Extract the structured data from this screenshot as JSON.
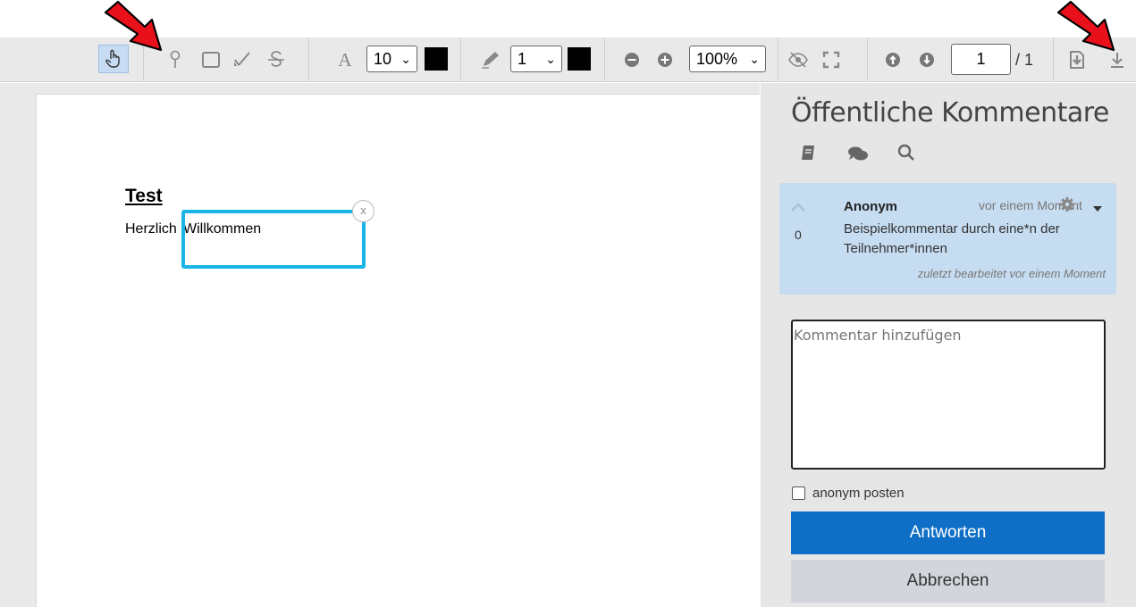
{
  "toolbar": {
    "font_size": "10",
    "line_width": "1",
    "zoom": "100%",
    "page_current": "1",
    "page_total": "/ 1",
    "colors": {
      "text_color": "#000000",
      "line_color": "#000000",
      "hand_active_bg": "#c7dcf3"
    },
    "icons": [
      "hand-pointer-icon",
      "map-pin-icon",
      "rectangle-icon",
      "highlighter-icon",
      "strikethrough-icon",
      "font-icon",
      "pencil-icon",
      "zoom-out-icon",
      "zoom-in-icon",
      "eye-slash-icon",
      "fullscreen-icon",
      "arrow-up-icon",
      "arrow-down-icon",
      "export-icon",
      "download-icon"
    ]
  },
  "document": {
    "heading": "Test",
    "body_text_1": "Herzlich",
    "body_text_2": "Willkommen",
    "annotation_close": "x",
    "annotation_color": "#1ab5e8"
  },
  "sidebar": {
    "title": "Öffentliche Kommentare",
    "comment": {
      "author": "Anonym",
      "time": "vor einem Moment",
      "votes": "0",
      "text_line1": "Beispielkommentar durch eine*n der",
      "text_line2": "Teilnehmer*innen",
      "edited": "zuletzt bearbeitet vor einem Moment",
      "bg": "#c6dcf1"
    },
    "input_placeholder": "Kommentar hinzufügen",
    "anonymous_label": "anonym posten",
    "reply_button": "Antworten",
    "cancel_button": "Abbrechen",
    "colors": {
      "primary": "#0f6fc6",
      "secondary": "#d2d6dc"
    }
  },
  "overlay": {
    "arrow_color": "#e8101a"
  }
}
